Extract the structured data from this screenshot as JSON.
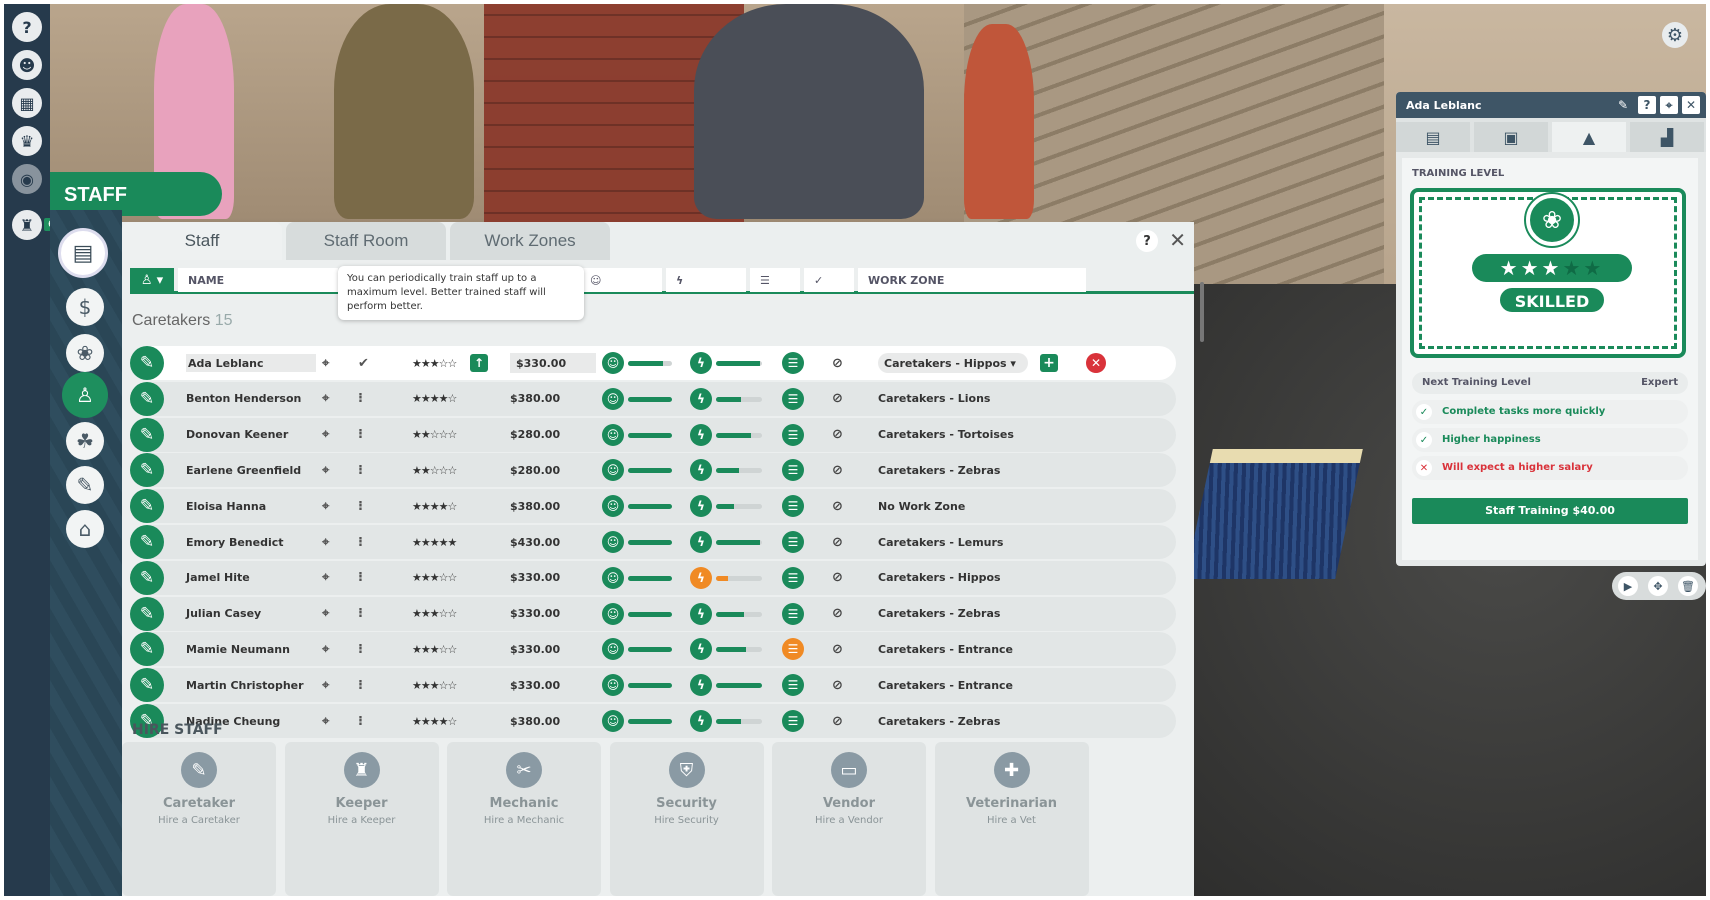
{
  "sidebar": {
    "top_icons": [
      "help-icon",
      "animal-icon",
      "calendar-icon",
      "trophy-icon",
      "eye-icon",
      "visitor-icon"
    ],
    "badge_count": "6",
    "title": "STAFF",
    "nav_icons": [
      "clipboard-icon",
      "finance-icon",
      "paw-icon",
      "staff-icon",
      "habitat-icon",
      "tools-icon",
      "shop-icon"
    ]
  },
  "tabs": [
    "Staff",
    "Staff Room",
    "Work Zones"
  ],
  "columns": {
    "name": "NAME",
    "work_zone": "WORK ZONE"
  },
  "tooltip": "You can periodically train staff up to a maximum level. Better trained staff will perform better.",
  "group": {
    "name": "Caretakers",
    "count": "15"
  },
  "rows": [
    {
      "name": "Ada Leblanc",
      "stars": 3,
      "salary": "$330.00",
      "happiness": 0.8,
      "energy": 0.95,
      "task_warn": false,
      "energy_warn": false,
      "zone": "Caretakers - Hippos",
      "selected": true
    },
    {
      "name": "Benton Henderson",
      "stars": 4,
      "salary": "$380.00",
      "happiness": 1.0,
      "energy": 0.55,
      "task_warn": false,
      "energy_warn": false,
      "zone": "Caretakers - Lions"
    },
    {
      "name": "Donovan Keener",
      "stars": 2,
      "salary": "$280.00",
      "happiness": 1.0,
      "energy": 0.75,
      "task_warn": false,
      "energy_warn": false,
      "zone": "Caretakers - Tortoises"
    },
    {
      "name": "Earlene Greenfield",
      "stars": 2,
      "salary": "$280.00",
      "happiness": 1.0,
      "energy": 0.5,
      "task_warn": false,
      "energy_warn": false,
      "zone": "Caretakers - Zebras"
    },
    {
      "name": "Eloisa Hanna",
      "stars": 4,
      "salary": "$380.00",
      "happiness": 1.0,
      "energy": 0.4,
      "task_warn": false,
      "energy_warn": false,
      "zone": "No Work Zone"
    },
    {
      "name": "Emory Benedict",
      "stars": 5,
      "salary": "$430.00",
      "happiness": 1.0,
      "energy": 0.95,
      "task_warn": false,
      "energy_warn": false,
      "zone": "Caretakers - Lemurs"
    },
    {
      "name": "Jamel Hite",
      "stars": 3,
      "salary": "$330.00",
      "happiness": 1.0,
      "energy": 0.25,
      "task_warn": false,
      "energy_warn": true,
      "zone": "Caretakers - Hippos"
    },
    {
      "name": "Julian Casey",
      "stars": 3,
      "salary": "$330.00",
      "happiness": 1.0,
      "energy": 0.6,
      "task_warn": false,
      "energy_warn": false,
      "zone": "Caretakers - Zebras"
    },
    {
      "name": "Mamie Neumann",
      "stars": 3,
      "salary": "$330.00",
      "happiness": 1.0,
      "energy": 0.65,
      "task_warn": true,
      "energy_warn": false,
      "zone": "Caretakers - Entrance"
    },
    {
      "name": "Martin Christopher",
      "stars": 3,
      "salary": "$330.00",
      "happiness": 1.0,
      "energy": 1.0,
      "task_warn": false,
      "energy_warn": false,
      "zone": "Caretakers - Entrance"
    },
    {
      "name": "Nadine Cheung",
      "stars": 4,
      "salary": "$380.00",
      "happiness": 1.0,
      "energy": 0.55,
      "task_warn": false,
      "energy_warn": false,
      "zone": "Caretakers - Zebras"
    }
  ],
  "hire": {
    "title": "HIRE STAFF",
    "cards": [
      {
        "label": "Caretaker",
        "sub": "Hire a Caretaker",
        "icon": "broom-icon"
      },
      {
        "label": "Keeper",
        "sub": "Hire a Keeper",
        "icon": "keeper-icon"
      },
      {
        "label": "Mechanic",
        "sub": "Hire a Mechanic",
        "icon": "wrench-icon"
      },
      {
        "label": "Security",
        "sub": "Hire Security",
        "icon": "shield-icon"
      },
      {
        "label": "Vendor",
        "sub": "Hire a Vendor",
        "icon": "vendor-icon"
      },
      {
        "label": "Veterinarian",
        "sub": "Hire a Vet",
        "icon": "vet-icon"
      }
    ]
  },
  "detail": {
    "name": "Ada Leblanc",
    "training_label": "TRAINING LEVEL",
    "stars_filled": 3,
    "stars_total": 5,
    "level": "SKILLED",
    "next_label": "Next Training Level",
    "next_value": "Expert",
    "benefits": [
      {
        "text": "Complete tasks more quickly",
        "good": true
      },
      {
        "text": "Higher happiness",
        "good": true
      },
      {
        "text": "Will expect a higher salary",
        "good": false
      }
    ],
    "train_button": "Staff Training $40.00"
  },
  "colors": {
    "accent": "#1a8a5a",
    "warning": "#f08a24",
    "danger": "#d9323a",
    "header": "#3e5566"
  }
}
